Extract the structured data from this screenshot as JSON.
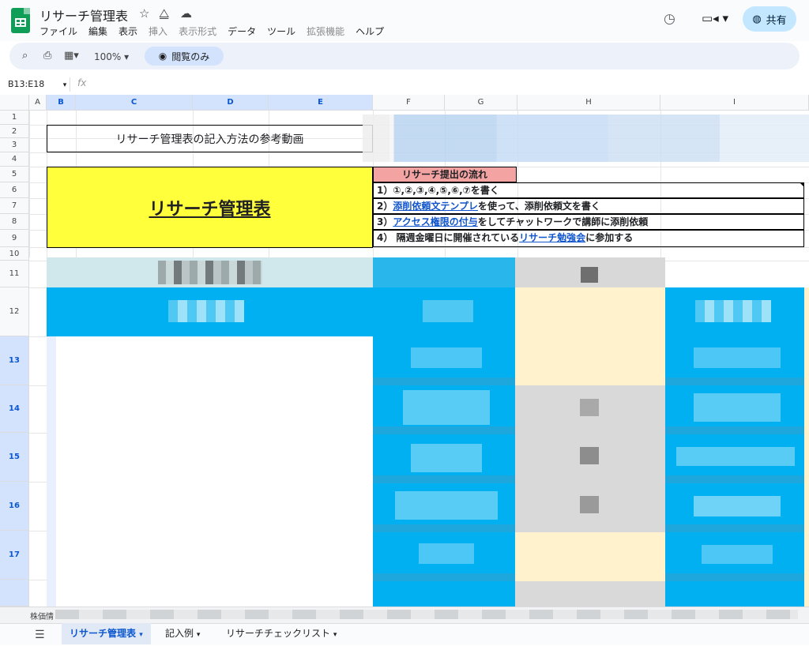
{
  "app": {
    "title": "リサーチ管理表",
    "menu": [
      {
        "label": "ファイル",
        "enabled": true
      },
      {
        "label": "編集",
        "enabled": true
      },
      {
        "label": "表示",
        "enabled": true
      },
      {
        "label": "挿入",
        "enabled": false
      },
      {
        "label": "表示形式",
        "enabled": false
      },
      {
        "label": "データ",
        "enabled": true
      },
      {
        "label": "ツール",
        "enabled": true
      },
      {
        "label": "拡張機能",
        "enabled": false
      },
      {
        "label": "ヘルプ",
        "enabled": true
      }
    ],
    "share_label": "共有",
    "icons": {
      "star": "star-icon",
      "drive": "move-to-drive-icon",
      "cloud": "cloud-saved-icon",
      "history": "history-icon",
      "meet": "video-call-icon",
      "globe": "globe-icon"
    }
  },
  "toolbar": {
    "zoom": "100%",
    "view_only": "閲覧のみ",
    "icons": [
      "search-icon",
      "print-icon",
      "format-paint-icon"
    ]
  },
  "formula_bar": {
    "name_box": "B13:E18",
    "fx": "fx"
  },
  "grid": {
    "columns": [
      "A",
      "B",
      "C",
      "D",
      "E",
      "F",
      "G",
      "H",
      "I"
    ],
    "selected_columns": [
      "B",
      "C",
      "D",
      "E"
    ],
    "rows": [
      "1",
      "2",
      "3",
      "4",
      "5",
      "6",
      "7",
      "8",
      "9",
      "10",
      "11",
      "12",
      "13",
      "14",
      "15",
      "16",
      "17"
    ],
    "selected_rows": [
      "13",
      "14",
      "15",
      "16",
      "17"
    ]
  },
  "sheet": {
    "ref_video": "リサーチ管理表の記入方法の参考動画",
    "management_title": "リサーチ管理表",
    "flow_header": "リサーチ提出の流れ",
    "step1": "1）①,②,③,④,⑤,⑥,⑦を書く",
    "step2_prefix": "2）",
    "step2_link": "添削依頼文テンプレ",
    "step2_suffix": "を使って、添削依頼文を書く",
    "step3_prefix": "3）",
    "step3_link": "アクセス権限の付与",
    "step3_suffix": "をしてチャットワークで講師に添削依頼",
    "step4_prefix": "4）  隔週金曜日に開催されている",
    "step4_link": "リサーチ勉強会",
    "step4_suffix": "に参加する"
  },
  "status": {
    "label": "株価情"
  },
  "tabs": [
    {
      "label": "リサーチ管理表",
      "active": true
    },
    {
      "label": "記入例",
      "active": false
    },
    {
      "label": "リサーチチェックリスト",
      "active": false
    }
  ],
  "colors": {
    "header_blue": "#00b0f0",
    "yellow": "#ffff3b",
    "pink": "#f4a3a3",
    "cream": "#fff2cc",
    "gray": "#d9d9d9",
    "link": "#1155cc"
  }
}
